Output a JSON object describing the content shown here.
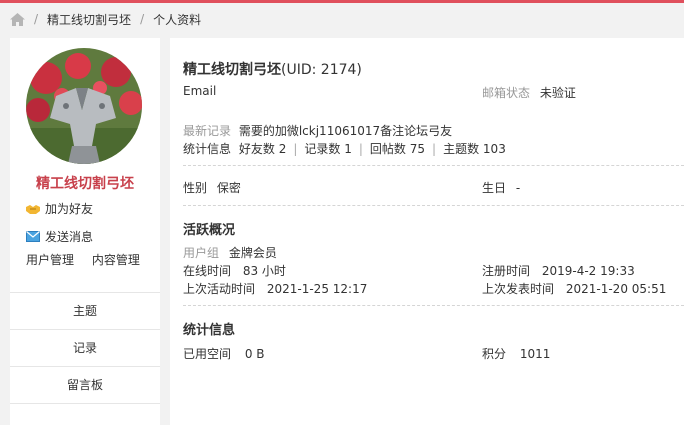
{
  "breadcrumb": {
    "items": [
      "精工线切割弓坯",
      "个人资料"
    ]
  },
  "sidebar": {
    "username": "精工线切割弓坯",
    "add_friend": "加为好友",
    "send_message": "发送消息",
    "user_manage": "用户管理",
    "content_manage": "内容管理",
    "nav": [
      "主题",
      "记录",
      "留言板"
    ]
  },
  "profile": {
    "name": "精工线切割弓坯",
    "uid": "(UID: 2174)",
    "email_label": "Email",
    "email_status_label": "邮箱状态",
    "email_status": "未验证",
    "latest_record_label": "最新记录",
    "latest_record": "需要的加微lckj11061017备注论坛弓友",
    "stats_label": "统计信息",
    "stats": [
      {
        "label": "好友数",
        "value": "2"
      },
      {
        "label": "记录数",
        "value": "1"
      },
      {
        "label": "回帖数",
        "value": "75"
      },
      {
        "label": "主题数",
        "value": "103"
      }
    ],
    "gender_label": "性别",
    "gender": "保密",
    "birthday_label": "生日",
    "birthday": "-"
  },
  "activity": {
    "title": "活跃概况",
    "group_label": "用户组",
    "group": "金牌会员",
    "online_label": "在线时间",
    "online": "83 小时",
    "register_label": "注册时间",
    "register": "2019-4-2 19:33",
    "last_active_label": "上次活动时间",
    "last_active": "2021-1-25 12:17",
    "last_post_label": "上次发表时间",
    "last_post": "2021-1-20 05:51"
  },
  "stats_section": {
    "title": "统计信息",
    "space_label": "已用空间",
    "space": "0 B",
    "points_label": "积分",
    "points": "1011"
  }
}
